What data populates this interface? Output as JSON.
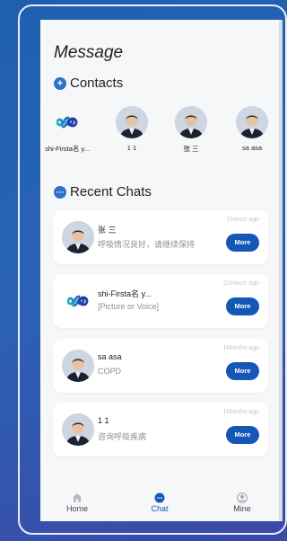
{
  "header": {
    "title": "Message"
  },
  "contacts": {
    "section_title": "Contacts",
    "section_icon": "plus-circle-icon",
    "items": [
      {
        "name": "shi-Firsta名 y...",
        "avatar": "infinity-logo-icon"
      },
      {
        "name": "1 1",
        "avatar": "person-avatar"
      },
      {
        "name": "张 三",
        "avatar": "person-avatar"
      },
      {
        "name": "sa asa",
        "avatar": "person-avatar"
      }
    ]
  },
  "recent_chats": {
    "section_title": "Recent Chats",
    "section_icon": "chat-dots-icon",
    "items": [
      {
        "name": "张 三",
        "message": "呼吸情况良好，请继续保持",
        "time": "1Hours ago",
        "action": "More",
        "avatar": "person-avatar"
      },
      {
        "name": "shi-Firsta名 y...",
        "message": "[Picture or Voice]",
        "time": "21Hours ago",
        "action": "More",
        "avatar": "infinity-logo-icon"
      },
      {
        "name": "sa asa",
        "message": "COPD",
        "time": "1Months ago",
        "action": "More",
        "avatar": "person-avatar"
      },
      {
        "name": "1 1",
        "message": "咨询呼吸疾病",
        "time": "1Months ago",
        "action": "More",
        "avatar": "person-avatar"
      }
    ]
  },
  "tabbar": {
    "tabs": [
      {
        "label": "Home",
        "icon": "home-icon"
      },
      {
        "label": "Chat",
        "icon": "chat-bubble-icon",
        "active": true
      },
      {
        "label": "Mine",
        "icon": "user-circle-icon"
      }
    ]
  },
  "colors": {
    "accent": "#1557b7",
    "background": "#2a63b6"
  }
}
